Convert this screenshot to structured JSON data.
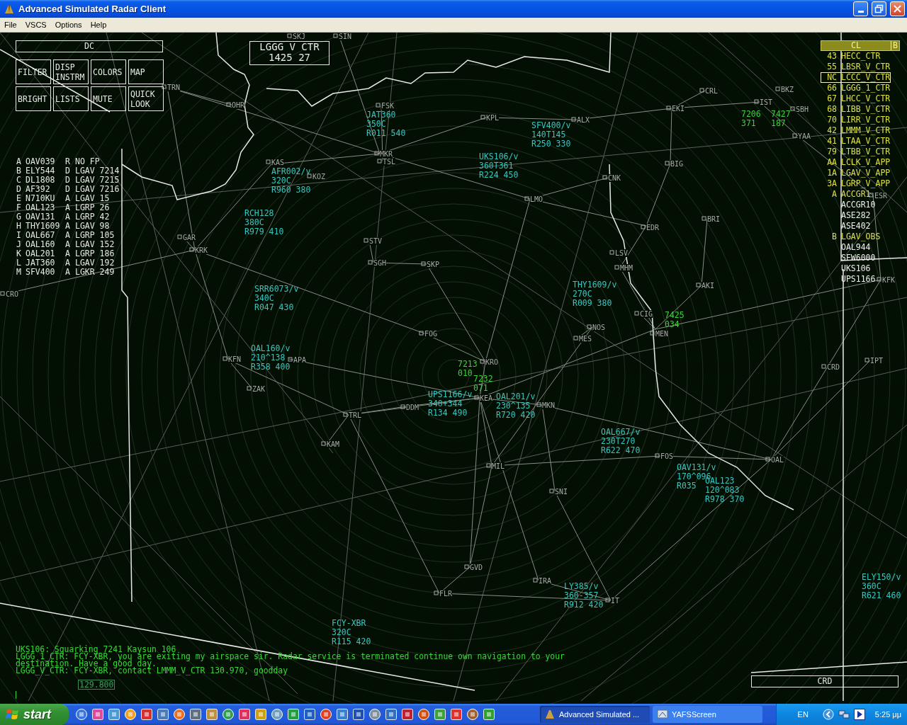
{
  "window": {
    "title": "Advanced Simulated Radar Client"
  },
  "menu": [
    "File",
    "VSCS",
    "Options",
    "Help"
  ],
  "scope": {
    "dc_bar": "DC",
    "panel_buttons": [
      "FILTER",
      "DISP INSTRM",
      "COLORS",
      "MAP",
      "BRIGHT",
      "LISTS",
      "MUTE",
      "QUICK LOOK"
    ],
    "sector_box": {
      "name": "LGGG V CTR",
      "time": "1425 27"
    },
    "aircraft_list": [
      {
        "letter": "A",
        "callsign": "OAV039",
        "flag": "R",
        "info": "NO FP"
      },
      {
        "letter": "B",
        "callsign": "ELY544",
        "flag": "D",
        "info": "LGAV 7214"
      },
      {
        "letter": "C",
        "callsign": "DL1808",
        "flag": "D",
        "info": "LGAV 7215"
      },
      {
        "letter": "D",
        "callsign": "AF392",
        "flag": "D",
        "info": "LGAV 7216"
      },
      {
        "letter": "E",
        "callsign": "N710KU",
        "flag": "A",
        "info": "LGAV 15"
      },
      {
        "letter": "F",
        "callsign": "OAL123",
        "flag": "A",
        "info": "LGRP 26"
      },
      {
        "letter": "G",
        "callsign": "OAV131",
        "flag": "A",
        "info": "LGRP 42"
      },
      {
        "letter": "H",
        "callsign": "THY1609",
        "flag": "A",
        "info": "LGAV 98"
      },
      {
        "letter": "I",
        "callsign": "OAL667",
        "flag": "A",
        "info": "LGRP 105"
      },
      {
        "letter": "J",
        "callsign": "OAL160",
        "flag": "A",
        "info": "LGAV 152"
      },
      {
        "letter": "K",
        "callsign": "OAL201",
        "flag": "A",
        "info": "LGRP 186"
      },
      {
        "letter": "L",
        "callsign": "JAT360",
        "flag": "A",
        "info": "LGAV 192"
      },
      {
        "letter": "M",
        "callsign": "SFV400",
        "flag": "A",
        "info": "LGKR 249"
      }
    ],
    "controller_list": {
      "title": "CL",
      "button": "B",
      "items": [
        {
          "code": "43",
          "name": "HECC_CTR",
          "kind": "controller",
          "selected": false
        },
        {
          "code": "55",
          "name": "LBSR_V_CTR",
          "kind": "controller",
          "selected": false
        },
        {
          "code": "NC",
          "name": "LCCC_V_CTR",
          "kind": "controller",
          "selected": true
        },
        {
          "code": "66",
          "name": "LGGG_1_CTR",
          "kind": "controller",
          "selected": false
        },
        {
          "code": "67",
          "name": "LHCC_V_CTR",
          "kind": "controller",
          "selected": false
        },
        {
          "code": "68",
          "name": "LIBB_V_CTR",
          "kind": "controller",
          "selected": false
        },
        {
          "code": "70",
          "name": "LIRR_V_CTR",
          "kind": "controller",
          "selected": false
        },
        {
          "code": "42",
          "name": "LMMM_V_CTR",
          "kind": "controller",
          "selected": false
        },
        {
          "code": "41",
          "name": "LTAA_V_CTR",
          "kind": "controller",
          "selected": false
        },
        {
          "code": "79",
          "name": "LTBB_V_CTR",
          "kind": "controller",
          "selected": false
        },
        {
          "code": "AA",
          "name": "LCLK_V_APP",
          "kind": "controller",
          "selected": false
        },
        {
          "code": "1A",
          "name": "LGAV_V_APP",
          "kind": "controller",
          "selected": false
        },
        {
          "code": "3A",
          "name": "LGRP_V_APP",
          "kind": "controller",
          "selected": false
        },
        {
          "code": "A",
          "name": "ACCGR1",
          "kind": "controller",
          "selected": false
        },
        {
          "name": "ACCGR10",
          "kind": "pilot",
          "selected": false
        },
        {
          "name": "ASE282",
          "kind": "pilot",
          "selected": false
        },
        {
          "name": "ASE402",
          "kind": "pilot",
          "selected": false
        },
        {
          "code": "B",
          "name": "LGAV_OBS",
          "kind": "controller",
          "selected": false
        },
        {
          "name": "OAL944",
          "kind": "pilot",
          "selected": false
        },
        {
          "name": "SEW6000",
          "kind": "pilot",
          "selected": false
        },
        {
          "name": "UKS106",
          "kind": "pilot",
          "selected": false
        },
        {
          "name": "UPS1166",
          "kind": "pilot",
          "selected": false
        }
      ]
    },
    "fixes": [
      "SKJ",
      "SIN",
      "TRN",
      "CRL",
      "BKZ",
      "OHR",
      "FSK",
      "EKI",
      "IST",
      "SBH",
      "KPL",
      "ALX",
      "YAA",
      "MKR",
      "KAS",
      "TSL",
      "BIG",
      "KOZ",
      "CNK",
      "LMO",
      "ESR",
      "BRI",
      "EDR",
      "GAR",
      "STV",
      "KRK",
      "LSV",
      "SGH",
      "SKP",
      "MHM",
      "AKI",
      "KFK",
      "CRO",
      "CIG",
      "FOG",
      "NOS",
      "MES",
      "MEN",
      "KFN",
      "APA",
      "KRO",
      "CRD",
      "IPT",
      "ZAK",
      "KEA",
      "DDM",
      "MKN",
      "TRL",
      "KAM",
      "FOS",
      "MIL",
      "OAL",
      "SNI",
      "GVD",
      "IRA",
      "FLR",
      "IT"
    ],
    "data_blocks": [
      {
        "kind": "correlated",
        "lines": [
          "JAT360",
          "350C",
          "R011 540"
        ]
      },
      {
        "kind": "correlated",
        "lines": [
          "SFV400/v",
          "140T145",
          "R250 330"
        ]
      },
      {
        "kind": "uncorrelated",
        "lines": [
          "7206",
          "371"
        ]
      },
      {
        "kind": "uncorrelated",
        "lines": [
          "7427",
          "187"
        ]
      },
      {
        "kind": "correlated",
        "lines": [
          "AFR002/v",
          "320C",
          "R960 380"
        ]
      },
      {
        "kind": "correlated",
        "lines": [
          "UKS106/v",
          "360T361",
          "R224 450"
        ]
      },
      {
        "kind": "correlated",
        "lines": [
          "RCH128",
          "380C",
          "R979 410"
        ]
      },
      {
        "kind": "correlated",
        "lines": [
          "SRR6073/v",
          "340C",
          "R047 430"
        ]
      },
      {
        "kind": "correlated",
        "lines": [
          "THY1609/v",
          "270C",
          "R009 380"
        ]
      },
      {
        "kind": "uncorrelated",
        "lines": [
          "7425",
          "034"
        ]
      },
      {
        "kind": "correlated",
        "lines": [
          "OAL160/v",
          "210^138",
          "R358 400"
        ]
      },
      {
        "kind": "uncorrelated",
        "lines": [
          "7213",
          "010"
        ]
      },
      {
        "kind": "correlated",
        "lines": [
          "UPS1166/v",
          "340+344",
          "R134 490"
        ]
      },
      {
        "kind": "uncorrelated",
        "lines": [
          "7232",
          "071"
        ]
      },
      {
        "kind": "correlated",
        "lines": [
          "OAL201/v",
          "230^135",
          "R720 420"
        ]
      },
      {
        "kind": "correlated",
        "lines": [
          "OAL667/v",
          "230T270",
          "R622 470"
        ]
      },
      {
        "kind": "correlated",
        "lines": [
          "OAV131/v",
          "170^096",
          "R035"
        ]
      },
      {
        "kind": "correlated",
        "lines": [
          "OAL123",
          "120^083",
          "R978 370"
        ]
      },
      {
        "kind": "correlated",
        "lines": [
          "LY385/v",
          "360-357",
          "R912 420"
        ]
      },
      {
        "kind": "correlated",
        "lines": [
          "ELY150/v",
          "360C",
          "R621 460"
        ]
      },
      {
        "kind": "correlated",
        "lines": [
          "FCY-XBR",
          "320C",
          "R115 420"
        ]
      }
    ],
    "messages": [
      "UKS106: Squarking 7241 Kaysun 106",
      "LGGG_1_CTR: FCY-XBR, you are exiting my airspace sir. Radar service is terminated continue own navigation to your destination. Have a good day.",
      "LGGG_V_CTR: FCY-XBR, contact LMMM_V_CTR 130.970, goodday"
    ],
    "frequency": "129.800",
    "crd_bar": "CRD"
  },
  "taskbar": {
    "start": "start",
    "tasks": [
      {
        "label": "Advanced Simulated ...",
        "selected": true
      },
      {
        "label": "YAFSScreen",
        "selected": false
      }
    ],
    "language": "EN",
    "clock": "5:25 μμ"
  }
}
